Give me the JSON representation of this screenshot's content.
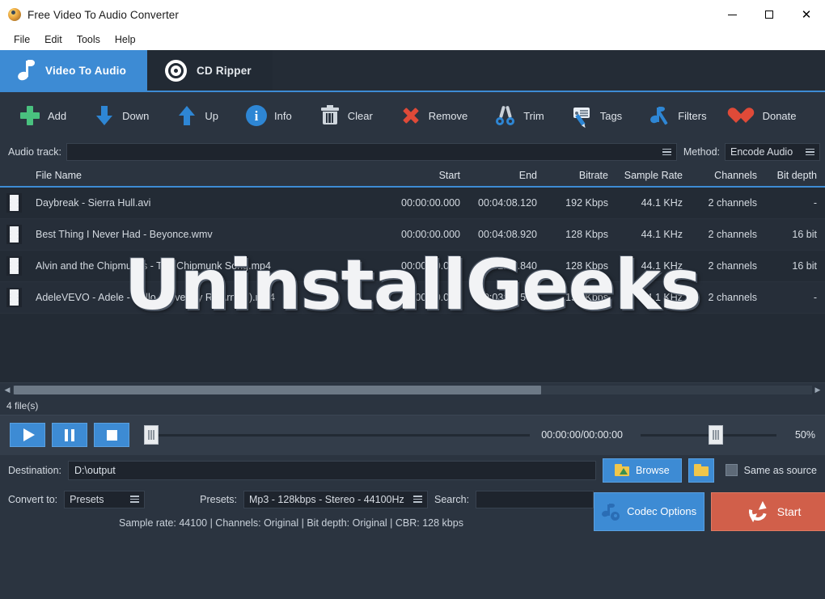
{
  "window": {
    "title": "Free Video To Audio Converter",
    "app_icon": "app-logo-icon",
    "minimize": "minimize-icon",
    "maximize": "maximize-icon",
    "close": "close-icon"
  },
  "menubar": {
    "items": [
      {
        "label": "File"
      },
      {
        "label": "Edit"
      },
      {
        "label": "Tools"
      },
      {
        "label": "Help"
      }
    ]
  },
  "tabs": [
    {
      "label": "Video To Audio",
      "icon": "music-note-icon",
      "active": true
    },
    {
      "label": "CD Ripper",
      "icon": "compact-disc-icon",
      "active": false
    }
  ],
  "toolbar": {
    "buttons": [
      {
        "label": "Add",
        "icon": "plus-icon"
      },
      {
        "label": "Down",
        "icon": "arrow-down-icon"
      },
      {
        "label": "Up",
        "icon": "arrow-up-icon"
      },
      {
        "label": "Info",
        "icon": "info-icon"
      },
      {
        "label": "Clear",
        "icon": "trash-icon"
      },
      {
        "label": "Remove",
        "icon": "cross-icon"
      },
      {
        "label": "Trim",
        "icon": "scissors-icon"
      },
      {
        "label": "Tags",
        "icon": "tag-pencil-icon"
      },
      {
        "label": "Filters",
        "icon": "note-wand-icon"
      },
      {
        "label": "Donate",
        "icon": "heart-icon"
      }
    ]
  },
  "track_row": {
    "audio_track_label": "Audio track:",
    "audio_track_value": "",
    "method_label": "Method:",
    "method_value": "Encode Audio"
  },
  "table": {
    "headers": {
      "file_name": "File Name",
      "start": "Start",
      "end": "End",
      "bitrate": "Bitrate",
      "sample_rate": "Sample Rate",
      "channels": "Channels",
      "bit_depth": "Bit depth"
    },
    "rows": [
      {
        "icon": "film-strip-icon",
        "file_name": "Daybreak - Sierra Hull.avi",
        "start": "00:00:00.000",
        "end": "00:04:08.120",
        "bitrate": "192 Kbps",
        "sample_rate": "44.1 KHz",
        "channels": "2 channels",
        "bit_depth": "-"
      },
      {
        "icon": "film-strip-icon",
        "file_name": "Best Thing I Never Had - Beyonce.wmv",
        "start": "00:00:00.000",
        "end": "00:04:08.920",
        "bitrate": "128 Kbps",
        "sample_rate": "44.1 KHz",
        "channels": "2 channels",
        "bit_depth": "16 bit"
      },
      {
        "icon": "film-strip-icon",
        "file_name": "Alvin and the Chipmunks - The Chipmunk Song.mp4",
        "start": "00:00:00.000",
        "end": "00:02:55.840",
        "bitrate": "128 Kbps",
        "sample_rate": "44.1 KHz",
        "channels": "2 channels",
        "bit_depth": "16 bit"
      },
      {
        "icon": "film-strip-icon",
        "file_name": "AdeleVEVO - Adele - Hello (Cover by RJ Arnold).mp4",
        "start": "00:00:00.000",
        "end": "00:03:57.560",
        "bitrate": "192 Kbps",
        "sample_rate": "44.1 KHz",
        "channels": "2 channels",
        "bit_depth": "-"
      }
    ],
    "file_count": "4 file(s)"
  },
  "watermark": {
    "text": "UninstallGeeks"
  },
  "scrollbar": {
    "left_arrow": "caret-left-icon",
    "right_arrow": "caret-right-icon"
  },
  "player": {
    "play": "play-icon",
    "pause": "pause-icon",
    "stop": "stop-icon",
    "seek_position_pct": 0,
    "time_display": "00:00:00/00:00:00",
    "volume_pct": "50%",
    "volume_position_pct": 50
  },
  "destination": {
    "label": "Destination:",
    "value": "D:\\output",
    "browse_label": "Browse",
    "browse_icon": "folder-browse-icon",
    "open_folder_icon": "open-folder-icon",
    "same_as_source_label": "Same as source",
    "same_as_source_checked": false
  },
  "bottom": {
    "convert_to_label": "Convert to:",
    "convert_to_value": "Presets",
    "presets_label": "Presets:",
    "presets_value": "Mp3 - 128kbps - Stereo - 44100Hz",
    "search_label": "Search:",
    "search_value": "",
    "status": "Sample rate: 44100 | Channels: Original | Bit depth: Original | CBR: 128 kbps",
    "codec_options_label": "Codec Options",
    "codec_options_icon": "note-gear-icon",
    "start_label": "Start",
    "start_icon": "refresh-arrows-icon"
  },
  "colors": {
    "accent_blue": "#3d8bd4",
    "panel_dark": "#2b3440",
    "table_bg": "#232b35",
    "start_red": "#d15f4a",
    "add_green": "#49c17f",
    "remove_red": "#df4a38"
  }
}
